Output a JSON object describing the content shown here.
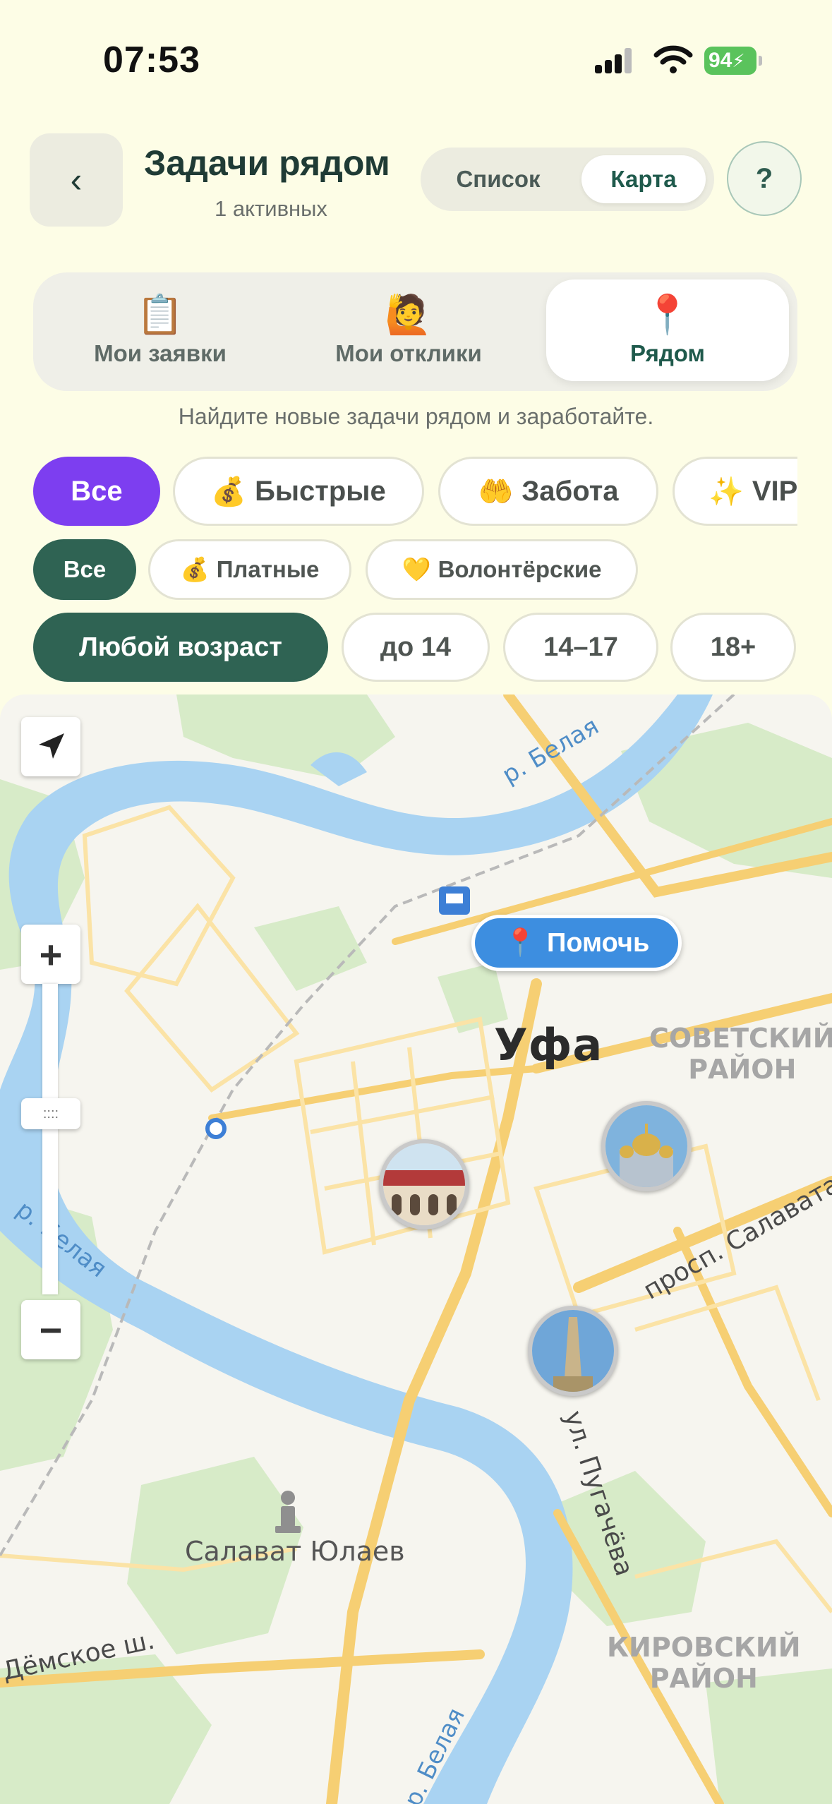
{
  "status_bar": {
    "time": "07:53",
    "battery": "94"
  },
  "header": {
    "back_icon": "chevron-left-icon",
    "back_glyph": "‹",
    "title": "Задачи рядом",
    "subtitle": "1 активных",
    "view_toggle": {
      "list_label": "Список",
      "map_label": "Карта",
      "selected": "Карта"
    },
    "help_label": "?"
  },
  "tabs": [
    {
      "icon": "clipboard-icon",
      "glyph": "📋",
      "label": "Мои заявки"
    },
    {
      "icon": "raising-hand-icon",
      "glyph": "🙋",
      "label": "Мои отклики"
    },
    {
      "icon": "pushpin-icon",
      "glyph": "📍",
      "label": "Рядом",
      "selected": true
    }
  ],
  "hint": "Найдите новые задачи рядом и заработайте.",
  "category_filters": [
    {
      "label": "Все",
      "glyph": "",
      "active": true
    },
    {
      "label": "Быстрые",
      "glyph": "💰",
      "active": false
    },
    {
      "label": "Забота",
      "glyph": "🤲",
      "active": false
    },
    {
      "label": "VIP",
      "glyph": "✨",
      "active": false
    }
  ],
  "payment_filters": [
    {
      "label": "Все",
      "glyph": "",
      "active": true
    },
    {
      "label": "Платные",
      "glyph": "💰",
      "active": false
    },
    {
      "label": "Волонтёрские",
      "glyph": "💛",
      "active": false
    }
  ],
  "age_filters": [
    {
      "label": "Любой возраст",
      "active": true
    },
    {
      "label": "до 14",
      "active": false
    },
    {
      "label": "14–17",
      "active": false
    },
    {
      "label": "18+",
      "active": false
    }
  ],
  "map": {
    "city_label": "Уфа",
    "district_sovetsky": [
      "СОВЕТСКИЙ",
      "РАЙОН"
    ],
    "district_kirovsky": [
      "КИРОВСКИЙ",
      "РАЙОН"
    ],
    "river_labels": [
      "р. Белая",
      "р. Белая",
      "р. Белая"
    ],
    "monument_label": "Салават Юлаев",
    "street_salavata": "просп. Салавата Ю",
    "street_pugacheva": "ул. Пугачёва",
    "street_demskoe": "Дёмское ш.",
    "help_marker": {
      "glyph": "📍",
      "label": "Помочь"
    },
    "zoom_in": "+",
    "zoom_out": "−",
    "zoom_handle": "::::",
    "colors": {
      "water": "#a9d3f2",
      "park": "#d7ebc8",
      "road": "#f6cf73",
      "marker": "#3d8ee0"
    }
  }
}
